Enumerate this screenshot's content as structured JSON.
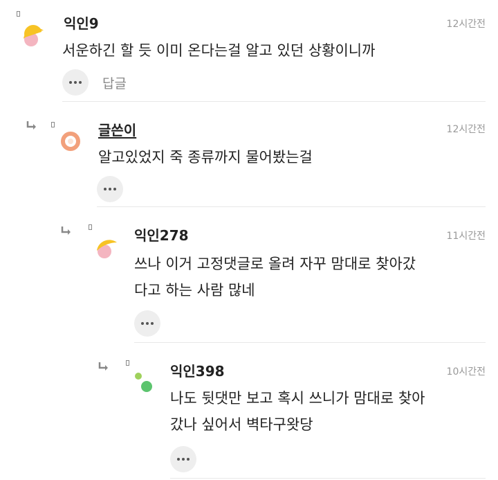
{
  "comments": [
    {
      "nickname": "익인9",
      "time": "12시간전",
      "text": "서운하긴 할 듯 이미 온다는걸 알고 있던 상황이니까",
      "more_icon": "ellipsis-icon",
      "reply_label": "답글",
      "avatar": "half-moon-avatar"
    },
    {
      "nickname": "글쓴이",
      "time": "12시간전",
      "text": "알고있었지 죽 종류까지 물어봤는걸",
      "more_icon": "ellipsis-icon",
      "avatar": "ring-avatar",
      "is_author": true
    },
    {
      "nickname": "익인278",
      "time": "11시간전",
      "text": "쓰나 이거 고정댓글로 올려 자꾸 맘대로 찾아갔\n다고 하는 사람 많네",
      "more_icon": "ellipsis-icon",
      "avatar": "half-moon-avatar"
    },
    {
      "nickname": "익인398",
      "time": "10시간전",
      "text": "나도 뒷댓만 보고 혹시 쓰니가 맘대로 찾아\n갔나 싶어서 벽타구왓당",
      "more_icon": "ellipsis-icon",
      "avatar": "two-dots-avatar"
    }
  ],
  "colors": {
    "moon_yellow": "#F7C325",
    "moon_pink": "#F4B5C0",
    "ring_orange": "#F2A07B",
    "dot_green": "#5CC46E",
    "dot_lime": "#9FD15C"
  }
}
